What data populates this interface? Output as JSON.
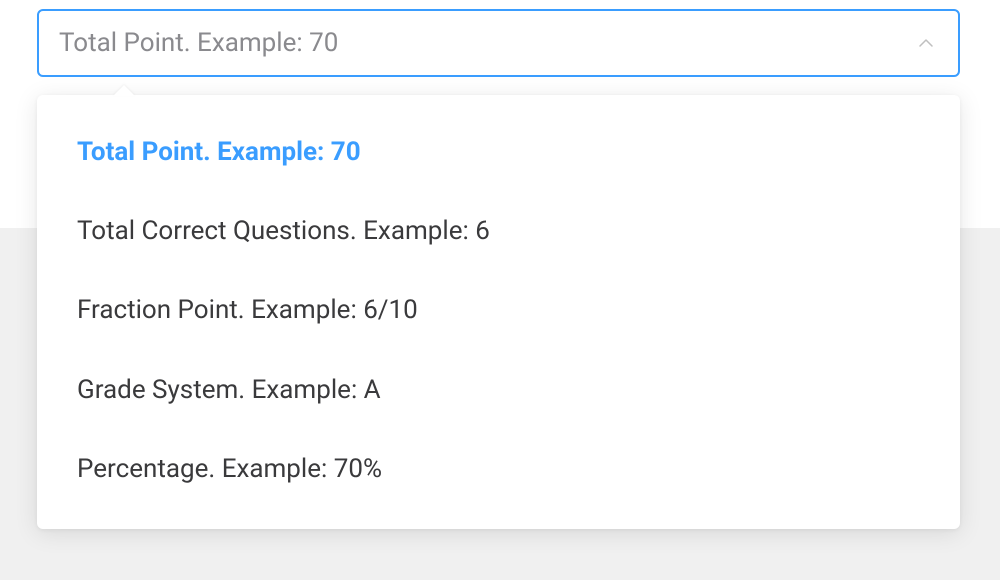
{
  "select": {
    "value": "Total Point. Example: 70",
    "options": [
      {
        "label": "Total Point. Example: 70",
        "selected": true
      },
      {
        "label": "Total Correct Questions. Example: 6",
        "selected": false
      },
      {
        "label": "Fraction Point. Example: 6/10",
        "selected": false
      },
      {
        "label": "Grade System. Example: A",
        "selected": false
      },
      {
        "label": "Percentage. Example: 70%",
        "selected": false
      }
    ]
  }
}
